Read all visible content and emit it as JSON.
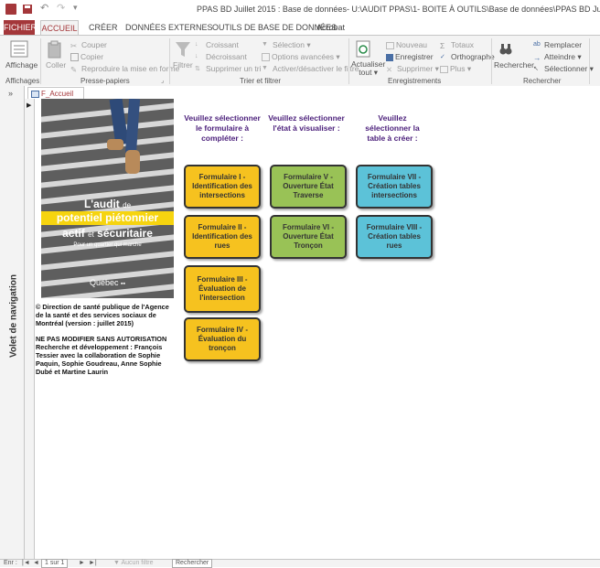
{
  "window": {
    "title": "PPAS BD Juillet 2015 : Base de données- U:\\AUDIT PPAS\\1- BOITE À OUTILS\\Base de données\\PPAS BD Juil"
  },
  "tabs": {
    "file": "FICHIER",
    "home": "ACCUEIL",
    "create": "CRÉER",
    "external": "DONNÉES EXTERNES",
    "dbtools": "OUTILS DE BASE DE DONNÉES",
    "acrobat": "Acrobat"
  },
  "ribbon": {
    "views": {
      "view_label": "Affichage",
      "group": "Affichages"
    },
    "clipboard": {
      "paste": "Coller",
      "cut": "Couper",
      "copy": "Copier",
      "format_painter": "Reproduire la mise en forme",
      "group": "Presse-papiers"
    },
    "sort": {
      "filter": "Filtrer",
      "asc": "Croissant",
      "desc": "Décroissant",
      "remove_sort": "Supprimer un tri",
      "selection": "Sélection",
      "advanced": "Options avancées",
      "toggle_filter": "Activer/désactiver le filtre",
      "group": "Trier et filtrer"
    },
    "records": {
      "refresh": "Actualiser",
      "refresh2": "tout",
      "new": "Nouveau",
      "save": "Enregistrer",
      "delete": "Supprimer",
      "totals": "Totaux",
      "spelling": "Orthographe",
      "more": "Plus",
      "group": "Enregistrements"
    },
    "find": {
      "find": "Rechercher",
      "replace": "Remplacer",
      "goto": "Atteindre",
      "select": "Sélectionner",
      "group": "Rechercher"
    }
  },
  "nav_pane": {
    "label": "Volet de navigation",
    "collapse": "»"
  },
  "document": {
    "tab_label": "F_Accueil"
  },
  "photo": {
    "line1": "L'audit",
    "line1_small": "de",
    "line2": "potentiel piétonnier",
    "line3a": "actif",
    "line3_small": "et",
    "line3b": "sécuritaire",
    "line4": "Pour un quartier qui marche",
    "logo": "Québec",
    "logo_mark": "▪▪"
  },
  "legal": {
    "p1": "© Direction de santé publique de l'Agence de la santé et des services sociaux de Montréal (version : juillet 2015)",
    "p2": "NE PAS MODIFIER SANS AUTORISATION Recherche et développement : François Tessier avec la collaboration de Sophie Paquin, Sophie Goudreau, Anne Sophie Dubé et Martine Laurin"
  },
  "columns": {
    "col1": "Veuillez sélectionner le formulaire à compléter :",
    "col2": "Veuillez sélectionner l'état à visualiser :",
    "col3": "Veuillez sélectionner la table à créer :"
  },
  "buttons": {
    "f1": "Formulaire I - Identification des intersections",
    "f2": "Formulaire II - Identification des rues",
    "f3": "Formulaire III - Évaluation de l'intersection",
    "f4": "Formulaire IV - Évaluation du tronçon",
    "f5": "Formulaire V - Ouverture État Traverse",
    "f6": "Formulaire VI - Ouverture État Tronçon",
    "f7": "Formulaire VII - Création tables intersections",
    "f8": "Formulaire VIII - Création tables rues"
  },
  "statusbar": {
    "record_label": "Enr :",
    "first": "|◄",
    "prev": "◄",
    "record_of": "1 sur 1",
    "next": "►",
    "last": "►|",
    "filter": "Aucun filtre",
    "search": "Rechercher"
  },
  "colors": {
    "file_tab": "#a4373a",
    "yellow": "#f6c21f",
    "green": "#99c256",
    "blue": "#5cc2d8"
  }
}
